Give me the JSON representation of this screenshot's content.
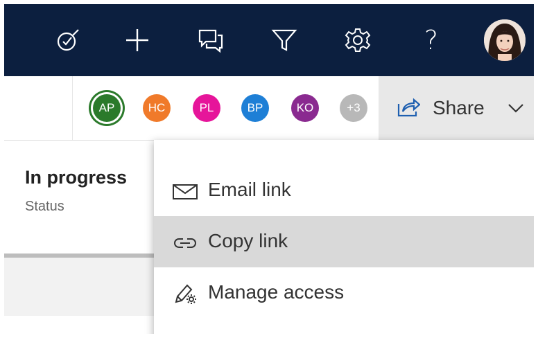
{
  "topbar": {
    "icons": [
      "target-check-icon",
      "plus-icon",
      "chat-icon",
      "filter-icon",
      "gear-icon",
      "help-icon"
    ],
    "help_glyph": "?",
    "user_avatar": "user-photo-avatar"
  },
  "collaborators": [
    {
      "initials": "AP",
      "color": "#2b7a2b"
    },
    {
      "initials": "HC",
      "color": "#f07a2a"
    },
    {
      "initials": "PL",
      "color": "#e6159a"
    },
    {
      "initials": "BP",
      "color": "#1e7fd6"
    },
    {
      "initials": "KO",
      "color": "#8a2a90"
    },
    {
      "initials": "+3",
      "color": "#b8b8b8"
    }
  ],
  "share": {
    "label": "Share",
    "icon": "share-arrow-icon",
    "chevron": "chevron-down-icon"
  },
  "status": {
    "value": "In progress",
    "label": "Status"
  },
  "menu": {
    "items": [
      {
        "label": "Email link",
        "icon": "envelope-icon"
      },
      {
        "label": "Copy link",
        "icon": "link-icon"
      },
      {
        "label": "Manage access",
        "icon": "pen-gear-icon"
      }
    ],
    "highlighted_index": 1
  },
  "colors": {
    "topbar": "#0c1f3f",
    "share_bg": "#e8e8e8",
    "menu_hover": "#d9d9d9"
  }
}
